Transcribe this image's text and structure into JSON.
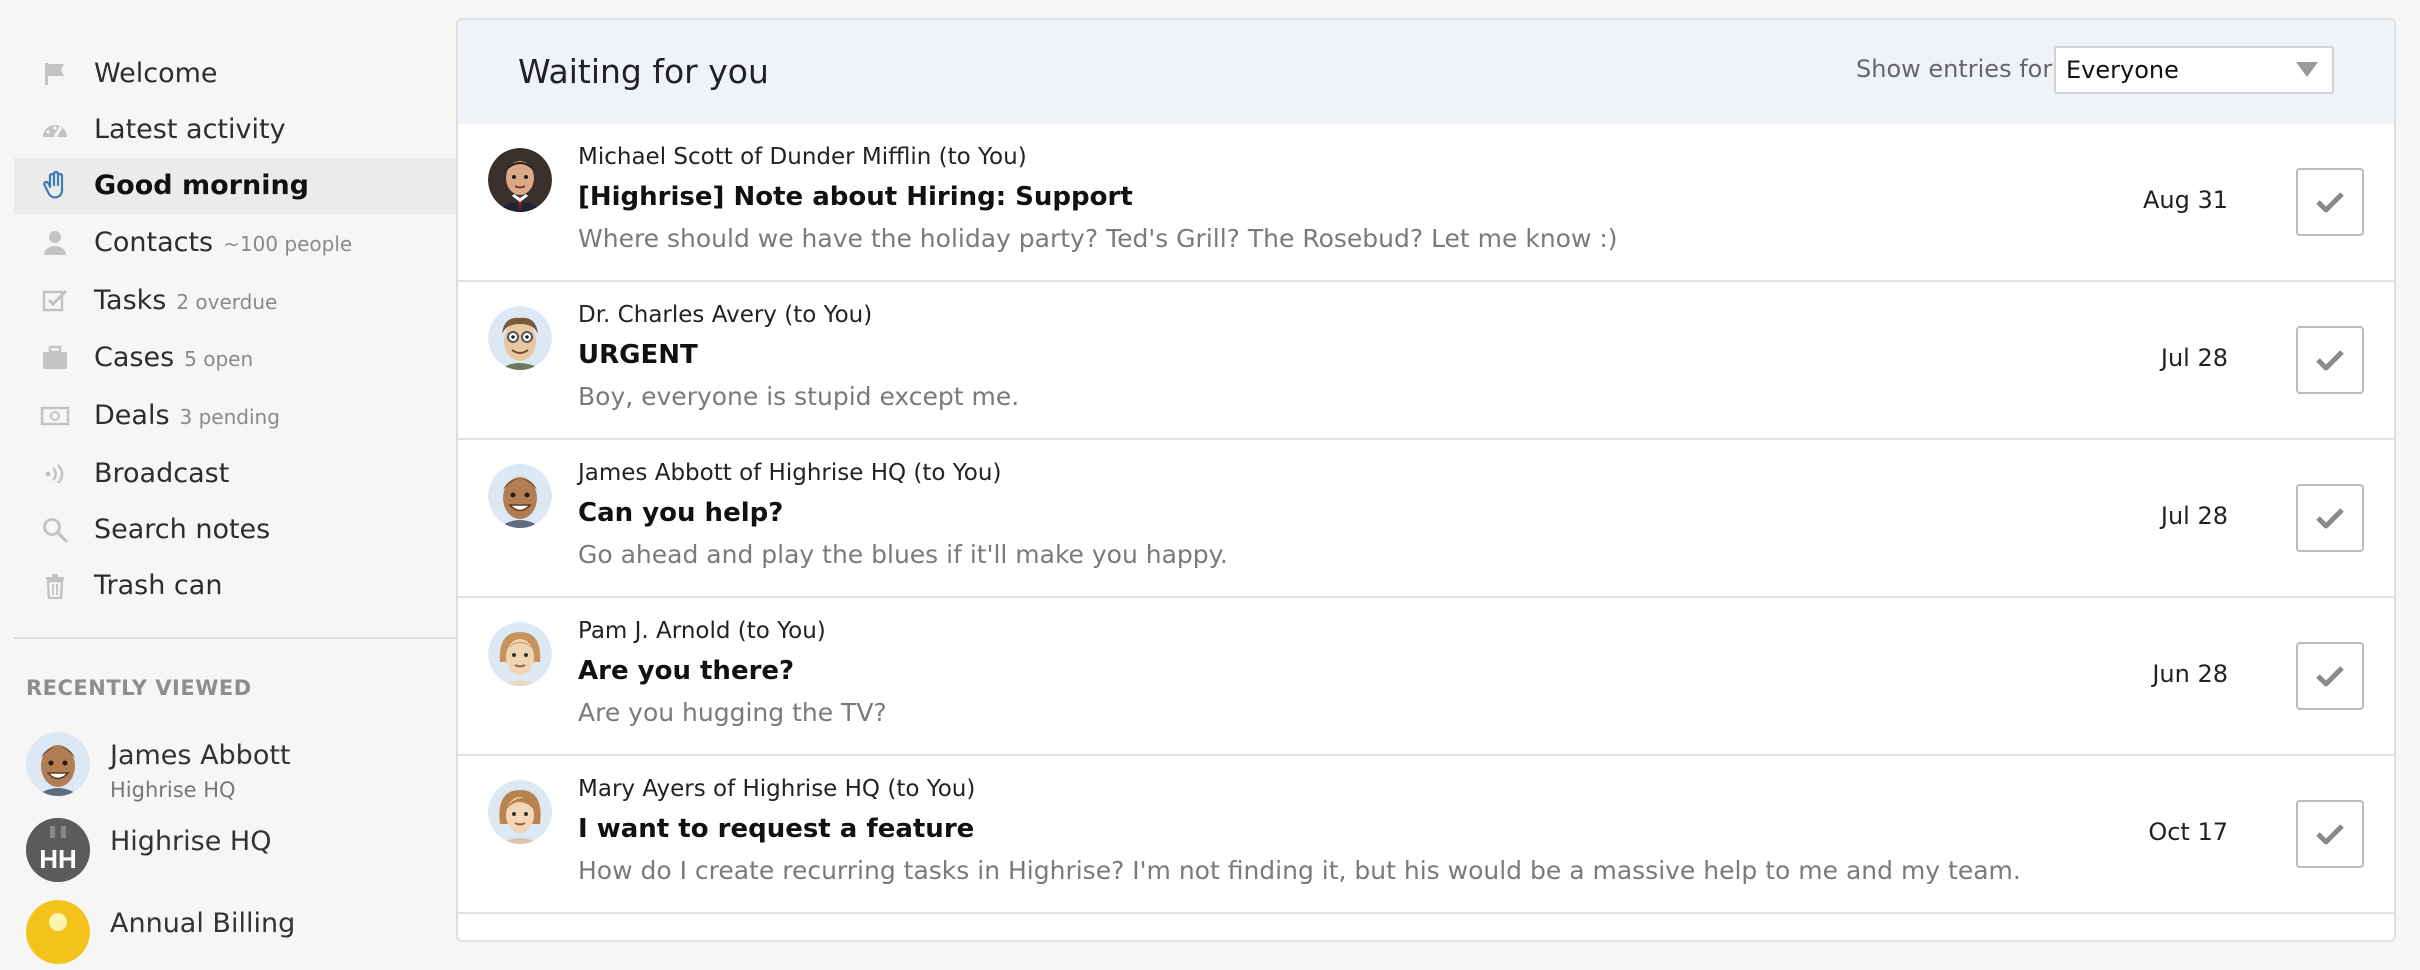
{
  "sidebar": {
    "items": [
      {
        "label": "Welcome",
        "sub": "",
        "icon": "flag-icon"
      },
      {
        "label": "Latest activity",
        "sub": "",
        "icon": "dashboard-icon"
      },
      {
        "label": "Good morning",
        "sub": "",
        "icon": "hand-wave-icon",
        "active": true
      },
      {
        "label": "Contacts",
        "sub": "~100 people",
        "icon": "person-icon"
      },
      {
        "label": "Tasks",
        "sub": "2 overdue",
        "icon": "checkbox-icon"
      },
      {
        "label": "Cases",
        "sub": "5 open",
        "icon": "briefcase-icon"
      },
      {
        "label": "Deals",
        "sub": "3 pending",
        "icon": "money-icon"
      },
      {
        "label": "Broadcast",
        "sub": "",
        "icon": "broadcast-icon"
      },
      {
        "label": "Search notes",
        "sub": "",
        "icon": "search-icon"
      },
      {
        "label": "Trash can",
        "sub": "",
        "icon": "trash-icon"
      }
    ],
    "recently_viewed": {
      "heading": "RECENTLY VIEWED",
      "items": [
        {
          "name": "James Abbott",
          "sub": "Highrise HQ"
        },
        {
          "name": "Highrise HQ",
          "sub": "",
          "initials": "HH"
        },
        {
          "name": "Annual Billing",
          "sub": ""
        }
      ]
    }
  },
  "main": {
    "title": "Waiting for you",
    "filter_label": "Show entries for",
    "filter_value": "Everyone",
    "entries": [
      {
        "from": "Michael Scott of Dunder Mifflin (to You)",
        "subject": "[Highrise] Note about Hiring: Support",
        "body": "Where should we have the holiday party? Ted's Grill? The Rosebud? Let me know :)",
        "date": "Aug 31"
      },
      {
        "from": "Dr. Charles Avery (to You)",
        "subject": "URGENT",
        "body": "Boy, everyone is stupid except me.",
        "date": "Jul 28"
      },
      {
        "from": "James Abbott of Highrise HQ (to You)",
        "subject": "Can you help?",
        "body": "Go ahead and play the blues if it'll make you happy.",
        "date": "Jul 28"
      },
      {
        "from": "Pam J. Arnold (to You)",
        "subject": "Are you there?",
        "body": "Are you hugging the TV?",
        "date": "Jun 28"
      },
      {
        "from": "Mary Ayers of Highrise HQ (to You)",
        "subject": "I want to request a feature",
        "body": "How do I create recurring tasks in Highrise? I'm not finding it, but his would be a massive help to me and my team.",
        "date": "Oct 17"
      }
    ]
  }
}
